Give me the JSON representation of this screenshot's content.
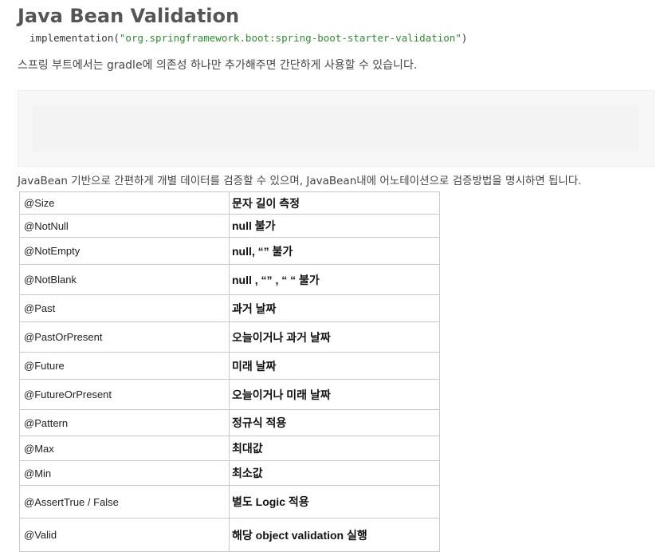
{
  "title": "Java Bean Validation",
  "intro": "스프링 부트에서는 gradle에 의존성 하나만 추가해주면 간단하게 사용할 수 있습니다.",
  "code": {
    "prefix": "implementation(",
    "string": "\"org.springframework.boot:spring-boot-starter-validation\"",
    "suffix": ")"
  },
  "description": "JavaBean 기반으로 간편하게 개별 데이터를 검증할 수 있으며, JavaBean내에 어노테이션으로 검증방법을 명시하면 됩니다.",
  "table": {
    "rows": [
      {
        "annotation": "@Size",
        "meaning": "문자 길이 측정"
      },
      {
        "annotation": "@NotNull",
        "meaning": "null 불가"
      },
      {
        "annotation": "@NotEmpty",
        "meaning": "null, “” 불가"
      },
      {
        "annotation": "@NotBlank",
        "meaning": "null , “” , “ “ 불가"
      },
      {
        "annotation": "@Past",
        "meaning": "과거 날짜"
      },
      {
        "annotation": "@PastOrPresent",
        "meaning": "오늘이거나 과거 날짜"
      },
      {
        "annotation": "@Future",
        "meaning": "미래 날짜"
      },
      {
        "annotation": "@FutureOrPresent",
        "meaning": "오늘이거나 미래 날짜"
      },
      {
        "annotation": "@Pattern",
        "meaning": "정규식 적용"
      },
      {
        "annotation": "@Max",
        "meaning": "최대값"
      },
      {
        "annotation": "@Min",
        "meaning": "최소값"
      },
      {
        "annotation": "@AssertTrue / False",
        "meaning": "별도 Logic 적용"
      },
      {
        "annotation": "@Valid",
        "meaning": "해당 object  validation 실행"
      }
    ]
  }
}
